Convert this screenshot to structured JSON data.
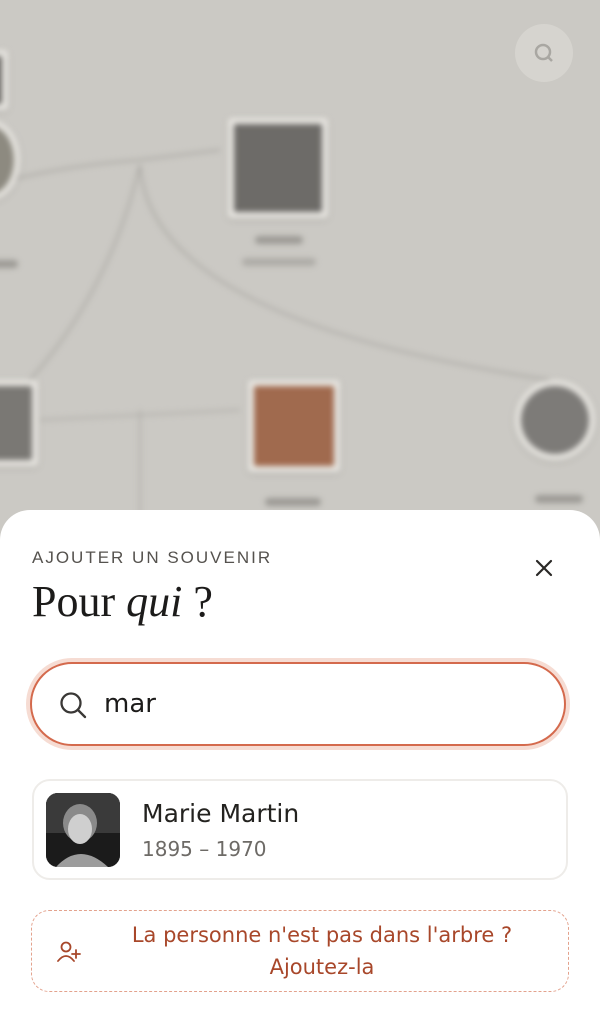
{
  "sheet": {
    "eyebrow": "AJOUTER UN SOUVENIR",
    "title_prefix": "Pour ",
    "title_emphasis": "qui",
    "title_suffix": " ?",
    "close_icon": "close-icon"
  },
  "search": {
    "value": "mar",
    "icon": "search-icon"
  },
  "results": [
    {
      "name": "Marie Martin",
      "dates": "1895 – 1970"
    }
  ],
  "add_person": {
    "line1": "La personne n'est pas dans l'arbre ?",
    "line2": "Ajoutez-la",
    "icon": "add-user-icon"
  },
  "colors": {
    "accent": "#d46a4d",
    "accent_text": "#a8472a",
    "background": "#cbc9c4"
  }
}
